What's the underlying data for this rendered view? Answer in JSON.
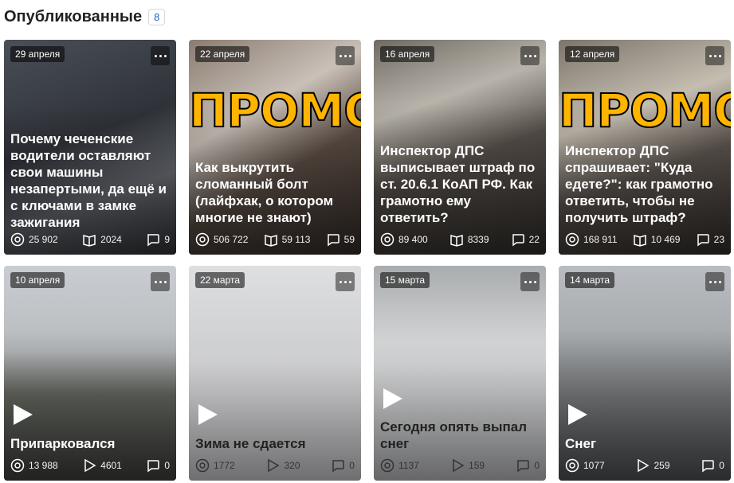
{
  "header": {
    "title": "Опубликованные",
    "count": "8"
  },
  "cards": [
    {
      "date": "29 апреля",
      "title": "Почему чеченские водители оставляют свои машины незапертыми, да ещё и с ключами в замке зажигания",
      "views": "25 902",
      "reads": "2024",
      "comments": "9",
      "stat2_icon": "book-icon",
      "promo": "",
      "video": false
    },
    {
      "date": "22 апреля",
      "title": "Как выкрутить сломанный болт (лайфхак, о котором многие не знают)",
      "views": "506 722",
      "reads": "59 113",
      "comments": "59",
      "stat2_icon": "book-icon",
      "promo": "ПРОМО",
      "video": false
    },
    {
      "date": "16 апреля",
      "title": "Инспектор ДПС выписывает штраф по ст. 20.6.1 КоАП РФ. Как грамотно ему ответить?",
      "views": "89 400",
      "reads": "8339",
      "comments": "22",
      "stat2_icon": "book-icon",
      "promo": "",
      "video": false
    },
    {
      "date": "12 апреля",
      "title": "Инспектор ДПС спрашивает: \"Куда едете?\": как грамотно ответить, чтобы не получить штраф?",
      "views": "168 911",
      "reads": "10 469",
      "comments": "23",
      "stat2_icon": "book-icon",
      "promo": "ПРОМО",
      "video": false
    },
    {
      "date": "10 апреля",
      "title": "Припарковался",
      "views": "13 988",
      "reads": "4601",
      "comments": "0",
      "stat2_icon": "play-icon",
      "promo": "",
      "video": true
    },
    {
      "date": "22 марта",
      "title": "Зима не сдается",
      "views": "1772",
      "reads": "320",
      "comments": "0",
      "stat2_icon": "play-icon",
      "promo": "",
      "video": true
    },
    {
      "date": "15 марта",
      "title": "Сегодня опять выпал снег",
      "views": "1137",
      "reads": "159",
      "comments": "0",
      "stat2_icon": "play-icon",
      "promo": "",
      "video": true
    },
    {
      "date": "14 марта",
      "title": "Снег",
      "views": "1077",
      "reads": "259",
      "comments": "0",
      "stat2_icon": "play-icon",
      "promo": "",
      "video": true
    }
  ],
  "colors": {
    "count_text": "#2a62c9",
    "promo_fill": "#ffb400"
  }
}
